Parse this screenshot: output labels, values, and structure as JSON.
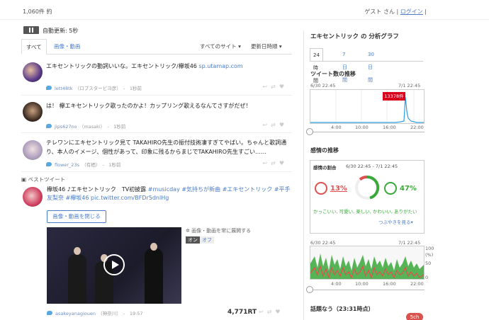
{
  "header": {
    "count": "1,060件 約",
    "guest": "ゲスト さん",
    "login": "ログイン"
  },
  "controls": {
    "auto_update": "自動更新: 5秒"
  },
  "tabs": {
    "all": "すべて",
    "media": "画像・動画",
    "site_filter": "すべてのサイト",
    "sort": "更新日時順"
  },
  "tweets": [
    {
      "text": "エキセントリックの動詞いいな。エキセントリック/欅坂46",
      "link": "sp.utamap.com",
      "user": "lett48tk",
      "name": "（ロブスタービヨ彦）",
      "time": "1秒前"
    },
    {
      "text": "は！ 欅エキセントリック歌ったのかよ！カップリング歌えるなんてさすがだぜ！",
      "link": "",
      "user": "jips627no",
      "name": "（masaki）",
      "time": "1秒前"
    },
    {
      "text": "テレワンにエキセントリック見て TAKAHIRO先生の振付技術凄すぎてやばい。ちゃんと歌詞通り、本人のイメージ、個性があって、印象に残るからまじでTAKAHIRO先生すごい……",
      "link": "",
      "user": "flower_23s",
      "name": "（有栖）",
      "time": "1秒前"
    }
  ],
  "best_tweet": {
    "label": "ベストツイート",
    "text": "欅坂46 ♪エキセントリック　TV初披露",
    "tags": "#musicday #気持ちが新曲 #エキセントリック #平手友梨奈 #欅坂46",
    "link": "pic.twitter.com/BFDr5dnlHg",
    "close_button": "画像・動画を閉じる",
    "media_note": "画像・動画を常に展開する",
    "on": "オン",
    "off": "オフ",
    "user": "asakeyanagiouen",
    "name": "（神奈川）",
    "time": "19:57",
    "rt": "4,771RT"
  },
  "analysis": {
    "title": "エキセントリック の 分析グラフ",
    "tabs": [
      "24時間",
      "7日間",
      "30日間"
    ],
    "tweet_count_title": "ツイート数の推移",
    "range_start": "6/30 22:45",
    "range_end": "7/1 22:45",
    "peak_label": "13378件",
    "x_ticks": [
      "4:00",
      "10:00",
      "16:00",
      "22:00"
    ],
    "sentiment_title": "感情の推移",
    "ratio_label": "感情の割合",
    "ratio_range": "6/30 22:45 - 7/1 22:45",
    "negative_pct": "13%",
    "positive_pct": "47%",
    "positive_words": "かっこいい, 可愛い, 楽しい, かわいい, ありがたい",
    "more_words": "つぶやきを見る",
    "y_ticks": [
      "100",
      "(%)",
      "50",
      "0"
    ],
    "trending_title": "話題なう（23:31時点）",
    "badge": "5ch",
    "colors": {
      "positive": "#3aa83a",
      "negative": "#e05050",
      "peak": "#d9001b",
      "spike": "#2e9ee0"
    }
  }
}
